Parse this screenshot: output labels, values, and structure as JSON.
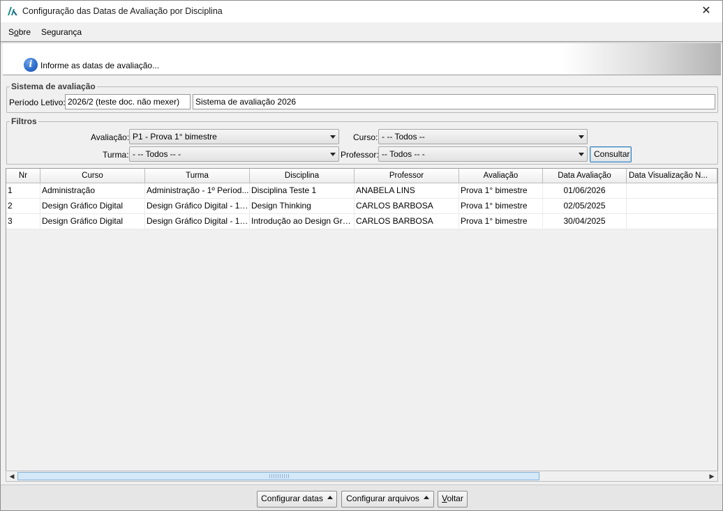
{
  "window": {
    "title": "Configuração das Datas de Avaliação por Disciplina",
    "close_glyph": "✕"
  },
  "menu": {
    "sobre": {
      "pre": "S",
      "acc": "o",
      "post": "bre"
    },
    "seguranca": "Segurança"
  },
  "banner": {
    "icon": "info-icon",
    "text": "Informe as datas de avaliação..."
  },
  "sistema": {
    "legend": "Sistema de avaliação",
    "periodo_label": "Período Letivo:",
    "periodo_value": "2026/2 (teste doc. não mexer)",
    "sistema_value": "Sistema de avaliação 2026"
  },
  "filtros": {
    "legend": "Filtros",
    "avaliacao_label": "Avaliação:",
    "avaliacao_value": "P1 - Prova 1° bimestre",
    "curso_label": "Curso:",
    "curso_value": "- -- Todos --",
    "turma_label": "Turma:",
    "turma_value": "- -- Todos -- -",
    "professor_label": "Professor:",
    "professor_value": "-- Todos -- -",
    "consultar": "Consultar"
  },
  "grid": {
    "columns": [
      "Nr",
      "Curso",
      "Turma",
      "Disciplina",
      "Professor",
      "Avaliação",
      "Data Avaliação",
      "Data Visualização N..."
    ],
    "rows": [
      [
        "1",
        "Administração",
        "Administração - 1º Períod...",
        "Disciplina Teste 1",
        "ANABELA LINS",
        "Prova 1° bimestre",
        "01/06/2026",
        ""
      ],
      [
        "2",
        "Design Gráfico Digital",
        "Design Gráfico Digital - 1º...",
        "Design Thinking",
        "CARLOS BARBOSA",
        "Prova 1° bimestre",
        "02/05/2025",
        ""
      ],
      [
        "3",
        "Design Gráfico Digital",
        "Design Gráfico Digital - 1º...",
        "Introdução ao Design Gráf...",
        "CARLOS BARBOSA",
        "Prova 1° bimestre",
        "30/04/2025",
        ""
      ]
    ]
  },
  "scrollbar": {
    "left_glyph": "◀",
    "right_glyph": "▶"
  },
  "footer": {
    "configurar_datas": "Configurar datas",
    "configurar_arquivos": "Configurar arquivos",
    "voltar": {
      "acc": "V",
      "post": "oltar"
    }
  },
  "colors": {
    "accent": "#3c7fb1",
    "info_icon": "#2f6fcf",
    "scroll_thumb": "#d4e8f8"
  }
}
